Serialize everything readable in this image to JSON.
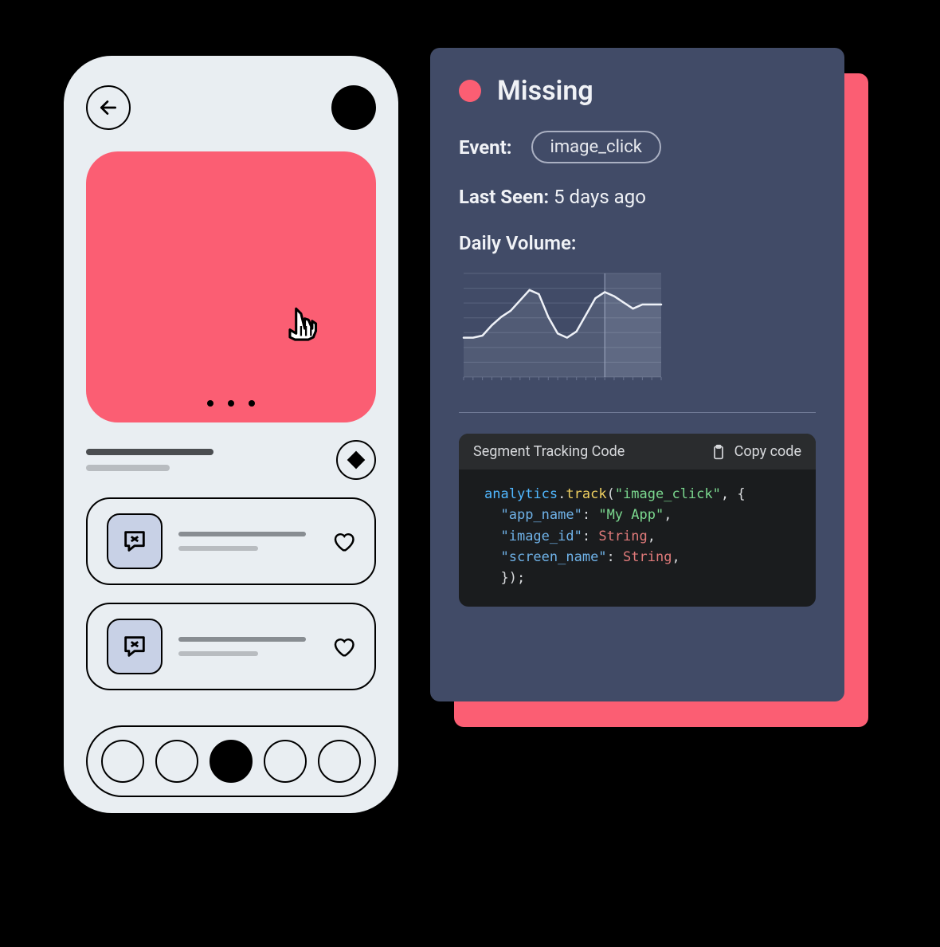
{
  "phone": {
    "hero_color": "#fb5e73",
    "pager_count": 3,
    "cards": [
      {
        "heart_filled": false
      },
      {
        "heart_filled": false
      }
    ],
    "tabbar_active_index": 2
  },
  "panel": {
    "status_label": "Missing",
    "status_color": "#fb5e73",
    "event_label": "Event:",
    "event_name": "image_click",
    "last_seen_label": "Last Seen:",
    "last_seen_value": "5 days ago",
    "daily_volume_label": "Daily Volume:",
    "code_title": "Segment Tracking Code",
    "copy_label": "Copy code",
    "code": {
      "fn_object": "analytics",
      "fn_name": "track",
      "event_arg": "\"image_click\"",
      "props": [
        {
          "key": "\"app_name\"",
          "value": "\"My App\"",
          "value_kind": "string"
        },
        {
          "key": "\"image_id\"",
          "value": "String",
          "value_kind": "type"
        },
        {
          "key": "\"screen_name\"",
          "value": "String",
          "value_kind": "type"
        }
      ]
    }
  },
  "chart_data": {
    "type": "area",
    "x": [
      0,
      1,
      2,
      3,
      4,
      5,
      6,
      7,
      8,
      9,
      10,
      11,
      12,
      13,
      14,
      15,
      16,
      17,
      18,
      19,
      20,
      21
    ],
    "values": [
      38,
      38,
      40,
      50,
      58,
      64,
      74,
      84,
      80,
      58,
      42,
      38,
      44,
      60,
      76,
      82,
      78,
      72,
      66,
      70,
      70,
      70
    ],
    "ylim": [
      0,
      100
    ],
    "highlight_start_x": 15,
    "title": "",
    "xlabel": "",
    "ylabel": ""
  }
}
